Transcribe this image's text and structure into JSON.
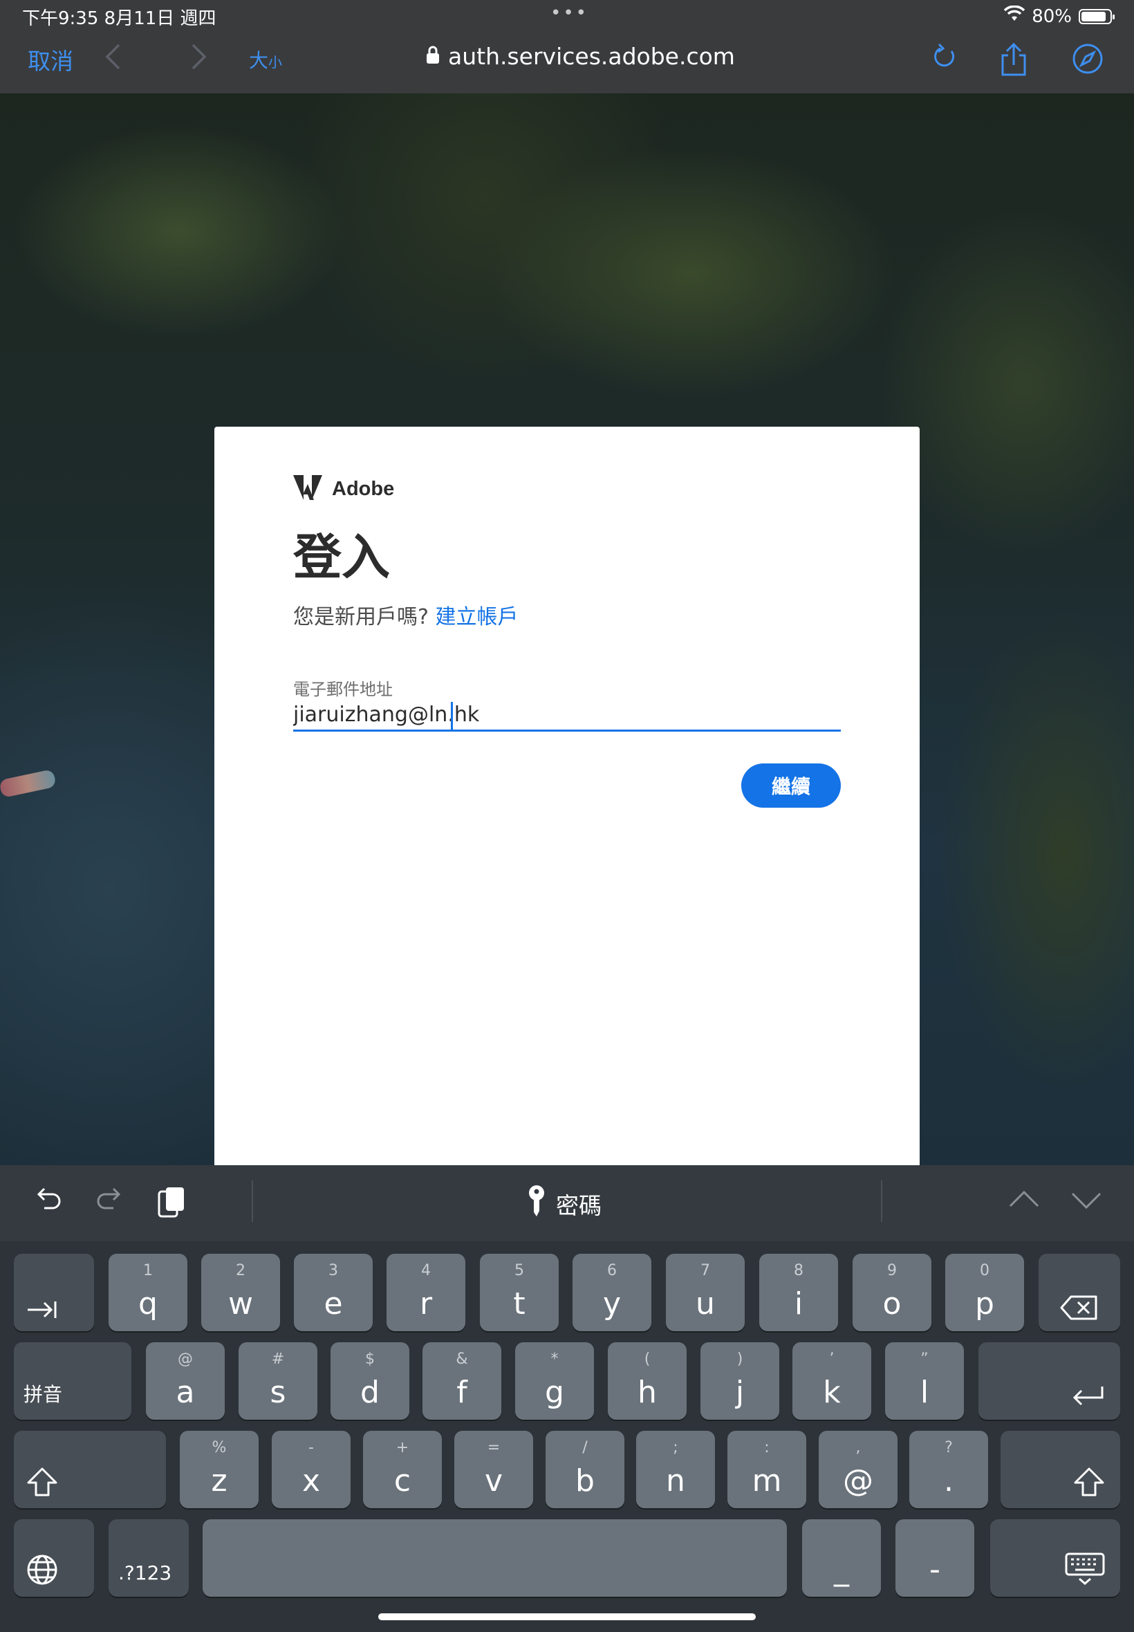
{
  "status_bar": {
    "time": "下午9:35   8月11日 週四",
    "dots": "•••",
    "battery": "80%"
  },
  "safari": {
    "cancel": "取消",
    "text_size_large": "大",
    "text_size_small": "小",
    "url": "auth.services.adobe.com",
    "accent_color": "#3e8ff0"
  },
  "signin": {
    "brand": "Adobe",
    "title": "登入",
    "new_user_prompt": "您是新用戶嗎?",
    "create_account": "建立帳戶",
    "email_label": "電子郵件地址",
    "email_value": "jiaruizhang@ln.hk",
    "continue": "繼續",
    "accent_color": "#1473e6"
  },
  "keyboard": {
    "password_suggestion": "密碼",
    "row1": [
      {
        "alt": "1",
        "key": "q"
      },
      {
        "alt": "2",
        "key": "w"
      },
      {
        "alt": "3",
        "key": "e"
      },
      {
        "alt": "4",
        "key": "r"
      },
      {
        "alt": "5",
        "key": "t"
      },
      {
        "alt": "6",
        "key": "y"
      },
      {
        "alt": "7",
        "key": "u"
      },
      {
        "alt": "8",
        "key": "i"
      },
      {
        "alt": "9",
        "key": "o"
      },
      {
        "alt": "0",
        "key": "p"
      }
    ],
    "row2": [
      {
        "alt": "@",
        "key": "a"
      },
      {
        "alt": "#",
        "key": "s"
      },
      {
        "alt": "$",
        "key": "d"
      },
      {
        "alt": "&",
        "key": "f"
      },
      {
        "alt": "*",
        "key": "g"
      },
      {
        "alt": "(",
        "key": "h"
      },
      {
        "alt": ")",
        "key": "j"
      },
      {
        "alt": "’",
        "key": "k"
      },
      {
        "alt": "”",
        "key": "l"
      }
    ],
    "row3": [
      {
        "alt": "%",
        "key": "z"
      },
      {
        "alt": "-",
        "key": "x"
      },
      {
        "alt": "+",
        "key": "c"
      },
      {
        "alt": "=",
        "key": "v"
      },
      {
        "alt": "/",
        "key": "b"
      },
      {
        "alt": ";",
        "key": "n"
      },
      {
        "alt": ":",
        "key": "m"
      },
      {
        "alt": ",",
        "key": "@"
      },
      {
        "alt": "?",
        "key": "."
      }
    ],
    "pinyin": "拼音",
    "numbers": ".?123",
    "underscore": "_",
    "dash": "-"
  }
}
